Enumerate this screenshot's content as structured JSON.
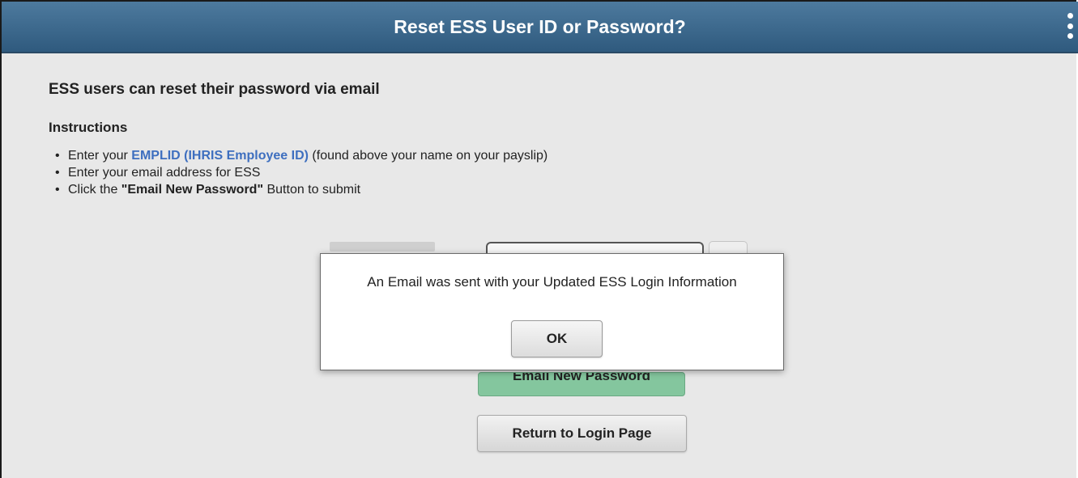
{
  "header": {
    "title": "Reset ESS User ID or Password?"
  },
  "main": {
    "heading": "ESS users can reset their password via email",
    "instructions_title": "Instructions",
    "instructions": {
      "item1": {
        "prefix": "Enter your ",
        "link": "EMPLID (IHRIS Employee ID)",
        "suffix": " (found above your name on your payslip)"
      },
      "item2": {
        "text": "Enter your email address for ESS"
      },
      "item3": {
        "prefix": "Click the ",
        "bold": "\"Email New Password\"",
        "suffix": " Button to submit"
      }
    },
    "email_button_label": "Email New Password",
    "return_button_label": "Return to Login Page"
  },
  "dialog": {
    "message": "An Email was sent with your Updated ESS Login Information",
    "ok_label": "OK"
  },
  "colors": {
    "header_bg": "#3a6689",
    "link": "#3e6fbf",
    "email_button": "#84c69e",
    "page_bg": "#e8e8e8"
  },
  "icons": {
    "menu": "vertical-ellipsis-icon"
  }
}
